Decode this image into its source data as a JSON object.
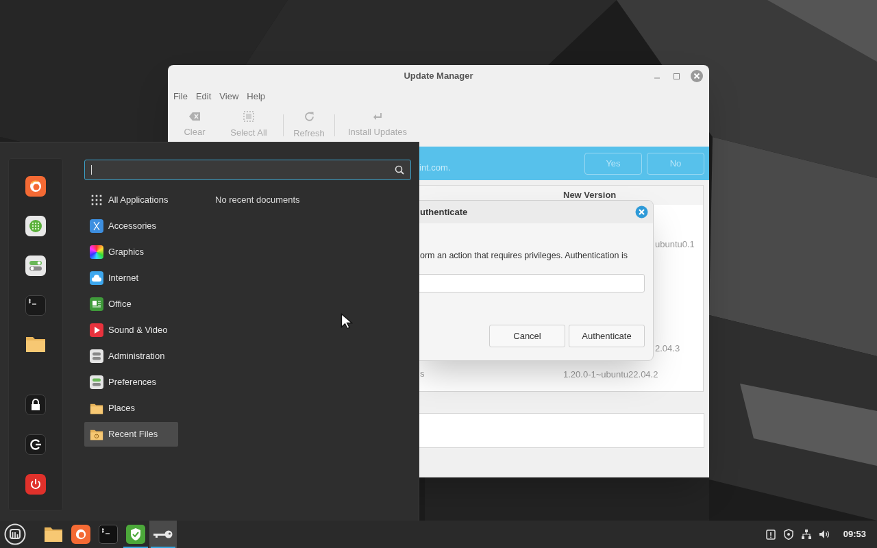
{
  "update_manager": {
    "title": "Update Manager",
    "menu": [
      "File",
      "Edit",
      "View",
      "Help"
    ],
    "toolbar": [
      {
        "kind": "clear",
        "label": "Clear",
        "disabled": true
      },
      {
        "kind": "select_all",
        "label": "Select All",
        "disabled": true
      },
      {
        "kind": "refresh",
        "label": "Refresh",
        "disabled": true
      },
      {
        "kind": "install",
        "label": "Install Updates",
        "disabled": true
      }
    ],
    "info_bar": {
      "text": "int.com.",
      "buttons": [
        "Yes",
        "No"
      ]
    },
    "table": {
      "columns": [
        "New Version"
      ],
      "rows": [
        {
          "new_version": "ubuntu0.1"
        },
        {
          "new_version": "2.04.3"
        },
        {
          "column_1": "s",
          "new_version": "1.20.0-1~ubuntu22.04.2"
        }
      ]
    }
  },
  "auth_dialog": {
    "title": "uthenticate",
    "message": "orm an action that requires privileges. Authentication is",
    "buttons": [
      "Cancel",
      "Authenticate"
    ]
  },
  "menu": {
    "categories": [
      {
        "label": "All Applications",
        "selected": false
      },
      {
        "label": "Accessories",
        "selected": false
      },
      {
        "label": "Graphics",
        "selected": false
      },
      {
        "label": "Internet",
        "selected": false
      },
      {
        "label": "Office",
        "selected": false
      },
      {
        "label": "Sound & Video",
        "selected": false
      },
      {
        "label": "Administration",
        "selected": false
      },
      {
        "label": "Preferences",
        "selected": false
      },
      {
        "label": "Places",
        "selected": false
      },
      {
        "label": "Recent Files",
        "selected": true
      }
    ],
    "empty_text": "No recent documents"
  },
  "taskbar": {
    "items": [
      {
        "running": false,
        "focused": false
      },
      {
        "running": false,
        "focused": false
      },
      {
        "running": false,
        "focused": false
      },
      {
        "running": true,
        "focused": false
      },
      {
        "running": true,
        "focused": true
      }
    ],
    "clock": "09:53"
  }
}
